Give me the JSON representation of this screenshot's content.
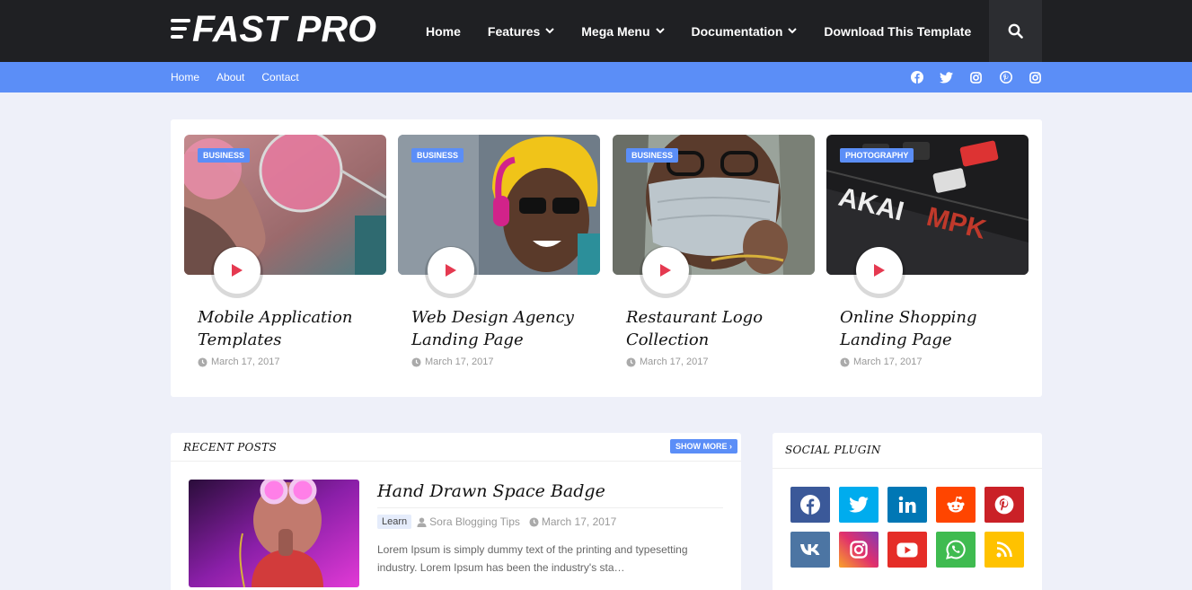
{
  "header": {
    "logo_text": "FAST PRO",
    "nav": [
      {
        "label": "Home"
      },
      {
        "label": "Features"
      },
      {
        "label": "Mega Menu"
      },
      {
        "label": "Documentation"
      },
      {
        "label": "Download This Template"
      }
    ],
    "search_icon": "search-icon"
  },
  "subnav": {
    "links": [
      {
        "label": "Home"
      },
      {
        "label": "About"
      },
      {
        "label": "Contact"
      }
    ],
    "social_icons": [
      "facebook-icon",
      "twitter-icon",
      "instagram-icon",
      "pinterest-icon",
      "instagram-icon"
    ]
  },
  "featured": [
    {
      "category": "BUSINESS",
      "title": "Mobile Application Templates",
      "date": "March 17, 2017"
    },
    {
      "category": "BUSINESS",
      "title": "Web Design Agency Landing Page",
      "date": "March 17, 2017"
    },
    {
      "category": "BUSINESS",
      "title": "Restaurant Logo Collection",
      "date": "March 17, 2017"
    },
    {
      "category": "PHOTOGRAPHY",
      "title": "Online Shopping Landing Page",
      "date": "March 17, 2017"
    }
  ],
  "recent": {
    "heading": "RECENT POSTS",
    "show_more": "SHOW MORE",
    "post": {
      "title": "Hand Drawn Space Badge",
      "tag": "Learn",
      "author": "Sora Blogging Tips",
      "date": "March 17, 2017",
      "excerpt": "Lorem Ipsum is simply dummy text of the printing and typesetting industry. Lorem Ipsum has been the industry's sta…"
    }
  },
  "social_plugin": {
    "heading": "SOCIAL PLUGIN",
    "buttons": [
      {
        "icon": "facebook-icon",
        "color": "#3b5999"
      },
      {
        "icon": "twitter-icon",
        "color": "#00acee"
      },
      {
        "icon": "linkedin-icon",
        "color": "#0077b5"
      },
      {
        "icon": "reddit-icon",
        "color": "#ff4500"
      },
      {
        "icon": "pinterest-icon",
        "color": "#ca2127"
      },
      {
        "icon": "vk-icon",
        "color": "#4c75a3"
      },
      {
        "icon": "instagram-icon",
        "color": "#c13584"
      },
      {
        "icon": "youtube-icon",
        "color": "#e52d27"
      },
      {
        "icon": "whatsapp-icon",
        "color": "#3fbb50"
      },
      {
        "icon": "rss-icon",
        "color": "#ffc200"
      }
    ]
  },
  "colors": {
    "accent": "#5b8ef7",
    "header_bg": "#1f2023",
    "page_bg": "#eef0f9",
    "play_red": "#e53950"
  }
}
